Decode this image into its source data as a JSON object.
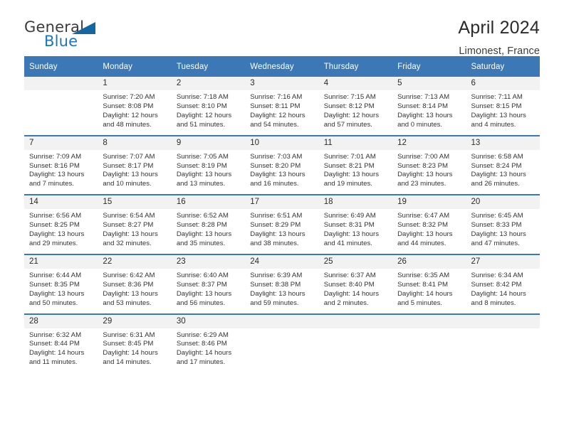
{
  "brand": {
    "name_part1": "General",
    "name_part2": "Blue",
    "accent_color": "#1b74bc",
    "triangle_color": "#14689f"
  },
  "header": {
    "title": "April 2024",
    "subtitle": "Limonest, France"
  },
  "calendar": {
    "header_bg": "#3b78b5",
    "daynum_bg": "#f2f2f2",
    "weekday_labels": [
      "Sunday",
      "Monday",
      "Tuesday",
      "Wednesday",
      "Thursday",
      "Friday",
      "Saturday"
    ],
    "weeks": [
      [
        {
          "day": "",
          "lines": []
        },
        {
          "day": "1",
          "lines": [
            "Sunrise: 7:20 AM",
            "Sunset: 8:08 PM",
            "Daylight: 12 hours",
            "and 48 minutes."
          ]
        },
        {
          "day": "2",
          "lines": [
            "Sunrise: 7:18 AM",
            "Sunset: 8:10 PM",
            "Daylight: 12 hours",
            "and 51 minutes."
          ]
        },
        {
          "day": "3",
          "lines": [
            "Sunrise: 7:16 AM",
            "Sunset: 8:11 PM",
            "Daylight: 12 hours",
            "and 54 minutes."
          ]
        },
        {
          "day": "4",
          "lines": [
            "Sunrise: 7:15 AM",
            "Sunset: 8:12 PM",
            "Daylight: 12 hours",
            "and 57 minutes."
          ]
        },
        {
          "day": "5",
          "lines": [
            "Sunrise: 7:13 AM",
            "Sunset: 8:14 PM",
            "Daylight: 13 hours",
            "and 0 minutes."
          ]
        },
        {
          "day": "6",
          "lines": [
            "Sunrise: 7:11 AM",
            "Sunset: 8:15 PM",
            "Daylight: 13 hours",
            "and 4 minutes."
          ]
        }
      ],
      [
        {
          "day": "7",
          "lines": [
            "Sunrise: 7:09 AM",
            "Sunset: 8:16 PM",
            "Daylight: 13 hours",
            "and 7 minutes."
          ]
        },
        {
          "day": "8",
          "lines": [
            "Sunrise: 7:07 AM",
            "Sunset: 8:17 PM",
            "Daylight: 13 hours",
            "and 10 minutes."
          ]
        },
        {
          "day": "9",
          "lines": [
            "Sunrise: 7:05 AM",
            "Sunset: 8:19 PM",
            "Daylight: 13 hours",
            "and 13 minutes."
          ]
        },
        {
          "day": "10",
          "lines": [
            "Sunrise: 7:03 AM",
            "Sunset: 8:20 PM",
            "Daylight: 13 hours",
            "and 16 minutes."
          ]
        },
        {
          "day": "11",
          "lines": [
            "Sunrise: 7:01 AM",
            "Sunset: 8:21 PM",
            "Daylight: 13 hours",
            "and 19 minutes."
          ]
        },
        {
          "day": "12",
          "lines": [
            "Sunrise: 7:00 AM",
            "Sunset: 8:23 PM",
            "Daylight: 13 hours",
            "and 23 minutes."
          ]
        },
        {
          "day": "13",
          "lines": [
            "Sunrise: 6:58 AM",
            "Sunset: 8:24 PM",
            "Daylight: 13 hours",
            "and 26 minutes."
          ]
        }
      ],
      [
        {
          "day": "14",
          "lines": [
            "Sunrise: 6:56 AM",
            "Sunset: 8:25 PM",
            "Daylight: 13 hours",
            "and 29 minutes."
          ]
        },
        {
          "day": "15",
          "lines": [
            "Sunrise: 6:54 AM",
            "Sunset: 8:27 PM",
            "Daylight: 13 hours",
            "and 32 minutes."
          ]
        },
        {
          "day": "16",
          "lines": [
            "Sunrise: 6:52 AM",
            "Sunset: 8:28 PM",
            "Daylight: 13 hours",
            "and 35 minutes."
          ]
        },
        {
          "day": "17",
          "lines": [
            "Sunrise: 6:51 AM",
            "Sunset: 8:29 PM",
            "Daylight: 13 hours",
            "and 38 minutes."
          ]
        },
        {
          "day": "18",
          "lines": [
            "Sunrise: 6:49 AM",
            "Sunset: 8:31 PM",
            "Daylight: 13 hours",
            "and 41 minutes."
          ]
        },
        {
          "day": "19",
          "lines": [
            "Sunrise: 6:47 AM",
            "Sunset: 8:32 PM",
            "Daylight: 13 hours",
            "and 44 minutes."
          ]
        },
        {
          "day": "20",
          "lines": [
            "Sunrise: 6:45 AM",
            "Sunset: 8:33 PM",
            "Daylight: 13 hours",
            "and 47 minutes."
          ]
        }
      ],
      [
        {
          "day": "21",
          "lines": [
            "Sunrise: 6:44 AM",
            "Sunset: 8:35 PM",
            "Daylight: 13 hours",
            "and 50 minutes."
          ]
        },
        {
          "day": "22",
          "lines": [
            "Sunrise: 6:42 AM",
            "Sunset: 8:36 PM",
            "Daylight: 13 hours",
            "and 53 minutes."
          ]
        },
        {
          "day": "23",
          "lines": [
            "Sunrise: 6:40 AM",
            "Sunset: 8:37 PM",
            "Daylight: 13 hours",
            "and 56 minutes."
          ]
        },
        {
          "day": "24",
          "lines": [
            "Sunrise: 6:39 AM",
            "Sunset: 8:38 PM",
            "Daylight: 13 hours",
            "and 59 minutes."
          ]
        },
        {
          "day": "25",
          "lines": [
            "Sunrise: 6:37 AM",
            "Sunset: 8:40 PM",
            "Daylight: 14 hours",
            "and 2 minutes."
          ]
        },
        {
          "day": "26",
          "lines": [
            "Sunrise: 6:35 AM",
            "Sunset: 8:41 PM",
            "Daylight: 14 hours",
            "and 5 minutes."
          ]
        },
        {
          "day": "27",
          "lines": [
            "Sunrise: 6:34 AM",
            "Sunset: 8:42 PM",
            "Daylight: 14 hours",
            "and 8 minutes."
          ]
        }
      ],
      [
        {
          "day": "28",
          "lines": [
            "Sunrise: 6:32 AM",
            "Sunset: 8:44 PM",
            "Daylight: 14 hours",
            "and 11 minutes."
          ]
        },
        {
          "day": "29",
          "lines": [
            "Sunrise: 6:31 AM",
            "Sunset: 8:45 PM",
            "Daylight: 14 hours",
            "and 14 minutes."
          ]
        },
        {
          "day": "30",
          "lines": [
            "Sunrise: 6:29 AM",
            "Sunset: 8:46 PM",
            "Daylight: 14 hours",
            "and 17 minutes."
          ]
        },
        {
          "day": "",
          "lines": []
        },
        {
          "day": "",
          "lines": []
        },
        {
          "day": "",
          "lines": []
        },
        {
          "day": "",
          "lines": []
        }
      ]
    ]
  }
}
